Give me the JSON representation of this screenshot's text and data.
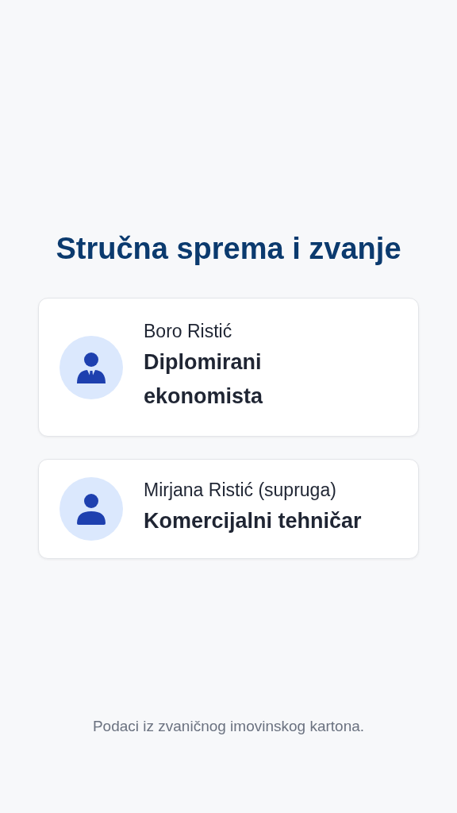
{
  "title": "Stručna sprema i zvanje",
  "people": [
    {
      "kind": "suit",
      "name": "Boro Ristić",
      "role": "Diplomirani ekonomista"
    },
    {
      "kind": "plain",
      "name": "Mirjana Ristić (supruga)",
      "role": "Komercijalni tehničar"
    }
  ],
  "footer": "Podaci iz zvaničnog imovinskog kartona."
}
